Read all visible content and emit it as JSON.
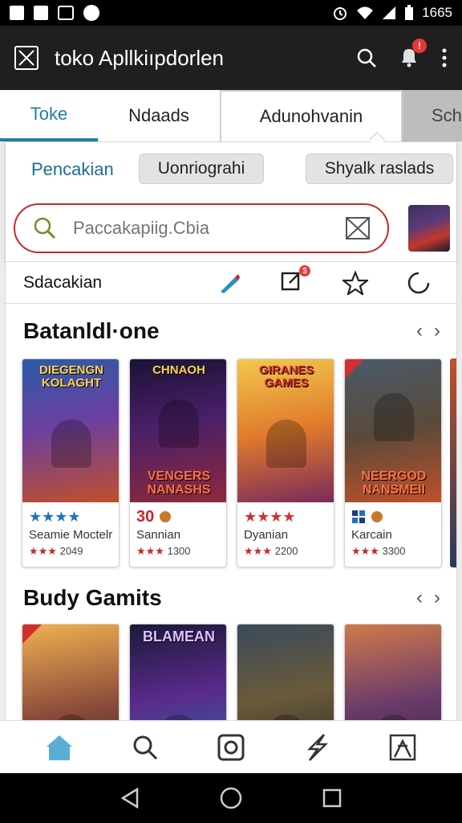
{
  "status_bar": {
    "time": "1665"
  },
  "app_bar": {
    "title": "toko Apllkiıpdorlen",
    "notification_badge": "!"
  },
  "tabs": [
    {
      "label": "Toke",
      "active": true
    },
    {
      "label": "Ndaads"
    },
    {
      "label": "Adunohvanin"
    },
    {
      "label": "Sch"
    }
  ],
  "filter": {
    "label": "Pencakian",
    "chips": [
      "Uonriograhi",
      "Shyalk raslads"
    ]
  },
  "search": {
    "placeholder": "Paccakapiig.Cbia"
  },
  "toolbar": {
    "label": "Sdacakian",
    "badge": "$"
  },
  "sections": [
    {
      "title": "Batanldl·one",
      "cards": [
        {
          "art_title": "DIEGENGN KOLAGHT",
          "art_sub": "",
          "rating_num": "",
          "stars": "★★★★",
          "name": "Seamie Moctelrs",
          "meta_stars": "★★★",
          "meta": "2049"
        },
        {
          "art_title": "CHNAOH",
          "art_sub": "VENGERS NANASHS",
          "rating_num": "30",
          "stars": "",
          "name": "Sannian",
          "meta_stars": "★★★",
          "meta": "1300"
        },
        {
          "art_title": "GIRANES GAMES",
          "art_sub": "",
          "rating_num": "",
          "stars": "★★★★",
          "name": "Dyanian",
          "meta_stars": "★★★",
          "meta": "2200"
        },
        {
          "art_title": "",
          "art_sub": "NEERGOD NANSMEII",
          "rating_num": "",
          "stars": "",
          "name": "Karcain",
          "meta_stars": "★★★",
          "meta": "3300"
        }
      ]
    },
    {
      "title": "Budy Gamits",
      "cards": [
        {
          "art_title": "",
          "art_sub": ""
        },
        {
          "art_title": "BLAMEAN",
          "art_sub": ""
        },
        {
          "art_title": "",
          "art_sub": ""
        },
        {
          "art_title": "",
          "art_sub": ""
        }
      ]
    }
  ],
  "colors": {
    "accent": "#1f7fa8",
    "search_border": "#c62828",
    "app_bar": "#1f1f1f"
  }
}
